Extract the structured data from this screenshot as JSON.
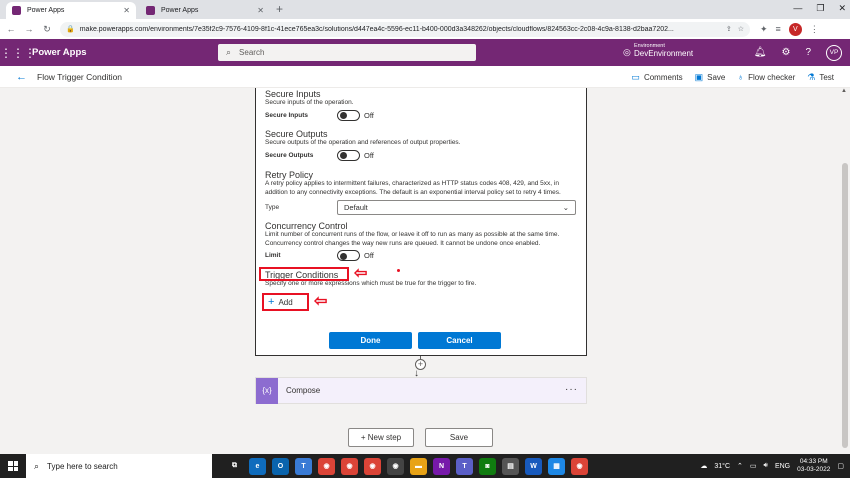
{
  "browser": {
    "tabs": [
      {
        "title": "Power Apps",
        "active": true
      },
      {
        "title": "Power Apps",
        "active": false
      }
    ],
    "new_tab_glyph": "+",
    "url": "make.powerapps.com/environments/7e35f2c9-7576-4109-8f1c-41ece765ea3c/solutions/d447ea4c-5596-ec11-b400-000d3a348262/objects/cloudflows/824563cc-2c08-4c9a-8138-d2baa7202...",
    "profile_initial": "V"
  },
  "app": {
    "name": "Power Apps",
    "search_placeholder": "Search",
    "environment_label": "Environment",
    "environment_name": "DevEnvironment",
    "user_initials": "VP",
    "brand_color": "#742774"
  },
  "commandbar": {
    "flow_name": "Flow Trigger Condition",
    "comments": "Comments",
    "save": "Save",
    "flow_checker": "Flow checker",
    "test": "Test"
  },
  "settings": {
    "secure_inputs": {
      "title": "Secure Inputs",
      "description": "Secure inputs of the operation.",
      "label": "Secure Inputs",
      "state": "Off"
    },
    "secure_outputs": {
      "title": "Secure Outputs",
      "description": "Secure outputs of the operation and references of output properties.",
      "label": "Secure Outputs",
      "state": "Off"
    },
    "retry_policy": {
      "title": "Retry Policy",
      "description": "A retry policy applies to intermittent failures, characterized as HTTP status codes 408, 429, and 5xx, in addition to any connectivity exceptions. The default is an exponential interval policy set to retry 4 times.",
      "type_label": "Type",
      "type_value": "Default"
    },
    "concurrency": {
      "title": "Concurrency Control",
      "description": "Limit number of concurrent runs of the flow, or leave it off to run as many as possible at the same time. Concurrency control changes the way new runs are queued. It cannot be undone once enabled.",
      "label": "Limit",
      "state": "Off"
    },
    "trigger_conditions": {
      "title": "Trigger Conditions",
      "description": "Specify one or more expressions which must be true for the trigger to fire.",
      "add_label": "Add"
    },
    "done_label": "Done",
    "cancel_label": "Cancel"
  },
  "compose": {
    "label": "Compose",
    "icon_text": "{x}"
  },
  "footer": {
    "new_step": "+ New step",
    "save": "Save"
  },
  "taskbar": {
    "search_placeholder": "Type here to search",
    "weather": "31°C",
    "language": "ENG",
    "time": "04:33 PM",
    "date": "03-03-2022"
  },
  "colors": {
    "accent": "#0078d4",
    "annotation_red": "#e81123",
    "compose_purple": "#8c6cd0"
  }
}
